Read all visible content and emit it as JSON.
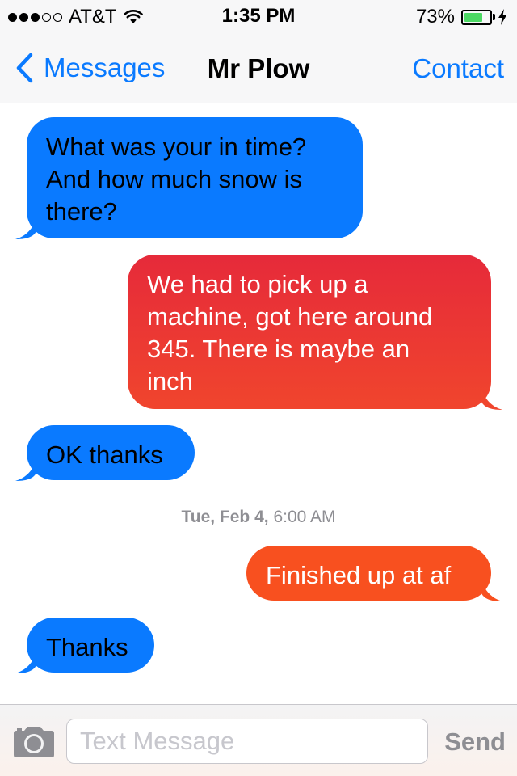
{
  "status_bar": {
    "carrier": "AT&T",
    "signal_bars_filled": 3,
    "signal_bars_total": 5,
    "time": "1:35 PM",
    "battery_percent_label": "73%",
    "battery_level": 0.73
  },
  "nav": {
    "back_label": "Messages",
    "title": "Mr Plow",
    "right_label": "Contact"
  },
  "messages": [
    {
      "direction": "incoming",
      "text_lines": [
        "What was your in time?",
        "And how much snow is",
        "there?"
      ]
    },
    {
      "direction": "outgoing",
      "text_lines": [
        "We had to pick up a",
        "machine, got here around",
        "345. There is maybe an",
        "inch"
      ]
    },
    {
      "direction": "incoming",
      "text_lines": [
        "OK thanks"
      ]
    },
    {
      "direction": "outgoing",
      "text_lines": [
        "Finished up at af"
      ]
    },
    {
      "direction": "incoming",
      "text_lines": [
        "Thanks"
      ]
    }
  ],
  "timestamp": {
    "day": "Tue, Feb 4,",
    "time": "6:00 AM"
  },
  "input_bar": {
    "placeholder": "Text Message",
    "send_label": "Send",
    "camera_icon": "camera-icon"
  },
  "colors": {
    "ios_blue": "#0a7aff",
    "incoming_bubble": "#0a7aff",
    "outgoing_red": "#e62a3a",
    "outgoing_orange": "#f8501f",
    "battery_green": "#4cd964",
    "muted_gray": "#8e8e93"
  }
}
